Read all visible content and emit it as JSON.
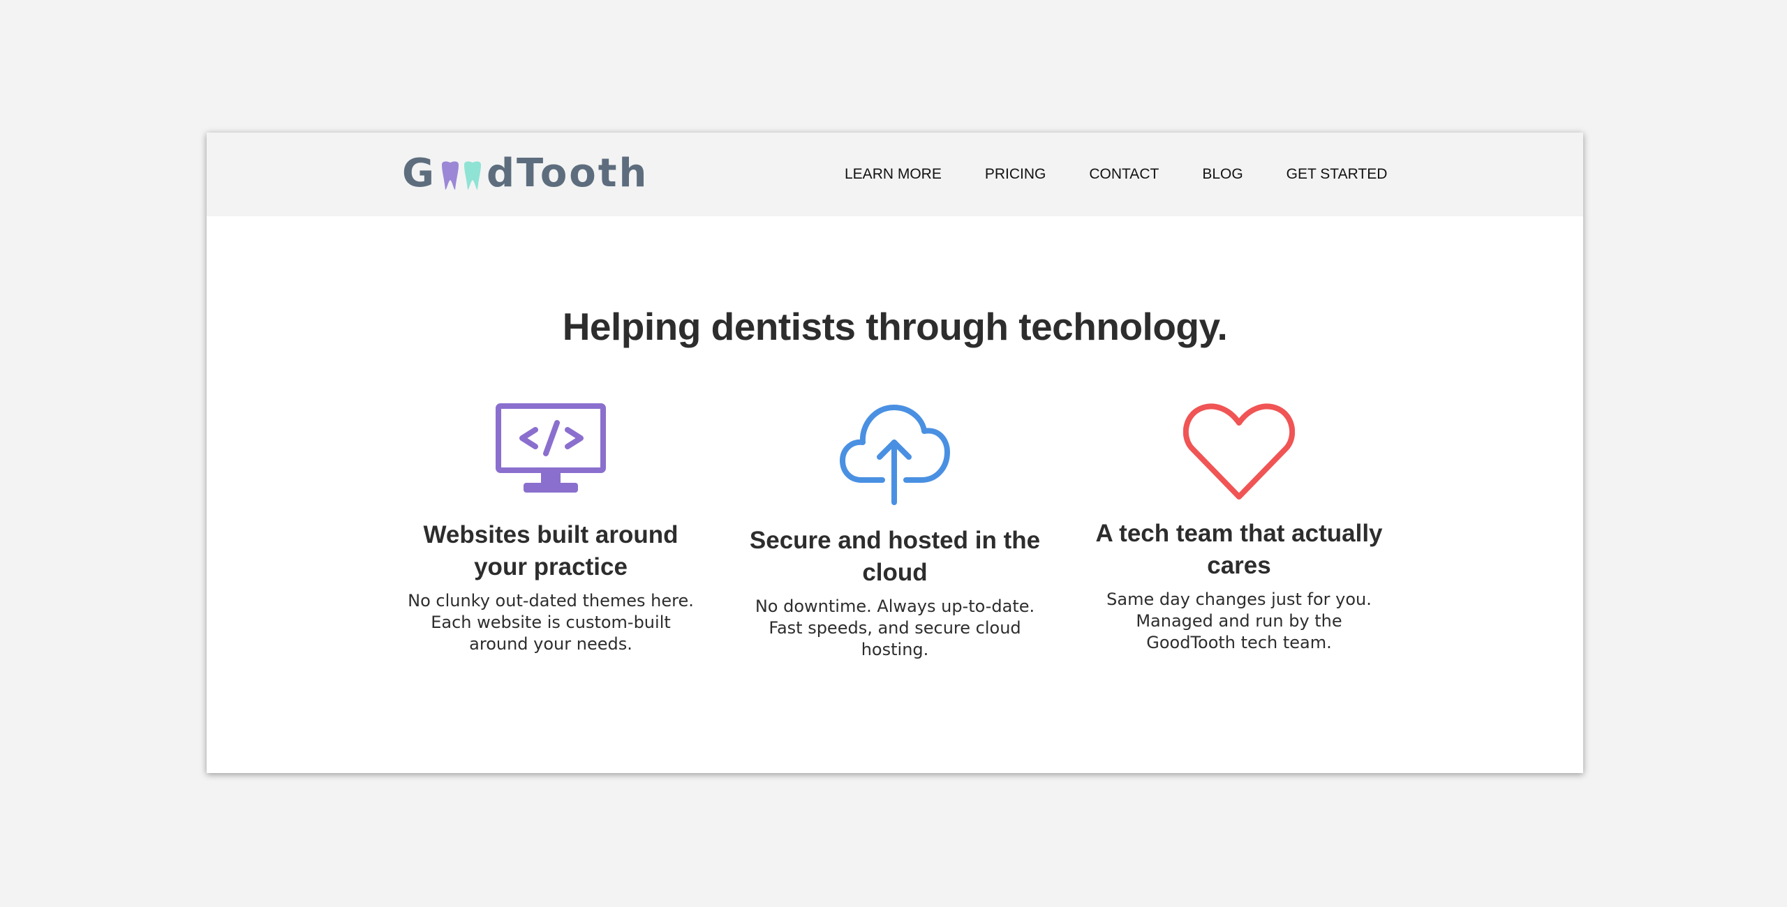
{
  "brand": {
    "name_prefix": "G",
    "name_suffix": "dTooth",
    "tooth_colors": [
      "#9b87d6",
      "#8fe3d4"
    ],
    "text_color": "#5d6d7e"
  },
  "nav": {
    "items": [
      {
        "label": "LEARN MORE"
      },
      {
        "label": "PRICING"
      },
      {
        "label": "CONTACT"
      },
      {
        "label": "BLOG"
      },
      {
        "label": "GET STARTED"
      }
    ]
  },
  "hero": {
    "headline": "Helping dentists through technology."
  },
  "features": [
    {
      "icon": "monitor-code-icon",
      "color": "#8a6fce",
      "title": "Websites built around your practice",
      "description": "No clunky out-dated themes here. Each website is custom-built around your needs."
    },
    {
      "icon": "cloud-upload-icon",
      "color": "#4a90e2",
      "title": "Secure and hosted in the cloud",
      "description": "No downtime. Always up-to-date. Fast speeds, and secure cloud hosting."
    },
    {
      "icon": "heart-icon",
      "color": "#f05454",
      "title": "A tech team that actually cares",
      "description": "Same day changes just for you. Managed and run by the GoodTooth tech team."
    }
  ]
}
